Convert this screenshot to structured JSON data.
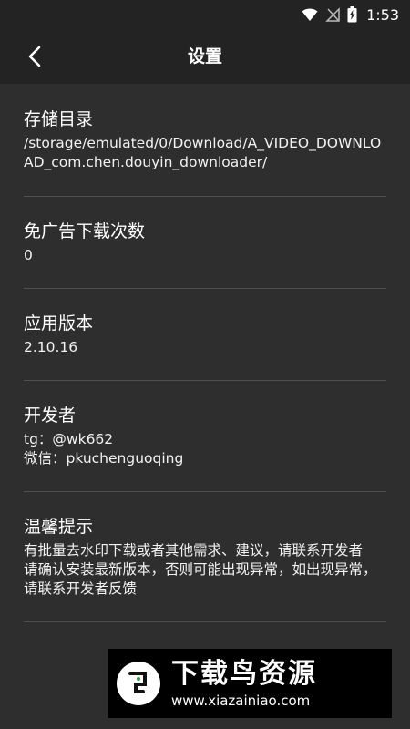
{
  "status_bar": {
    "time": "1:53",
    "icons": [
      "wifi-icon",
      "signal-off-icon",
      "battery-charging-icon"
    ]
  },
  "app_bar": {
    "title": "设置",
    "back_icon": "chevron-left-icon"
  },
  "settings": {
    "storage": {
      "title": "存储目录",
      "value": "/storage/emulated/0/Download/A_VIDEO_DOWNLOAD_com.chen.douyin_downloader/"
    },
    "ad_free": {
      "title": "免广告下载次数",
      "value": "0"
    },
    "version": {
      "title": "应用版本",
      "value": "2.10.16"
    },
    "developer": {
      "title": "开发者",
      "lines": [
        "tg：@wk662",
        "微信：pkuchenguoqing"
      ]
    },
    "tips": {
      "title": "温馨提示",
      "lines": [
        "有批量去水印下载或者其他需求、建议，请联系开发者",
        "请确认安装最新版本，否则可能出现异常，如出现异常，请联系开发者反馈"
      ]
    }
  },
  "watermark": {
    "brand": "下载鸟资源",
    "url": "www.xiazainiao.com"
  },
  "colors": {
    "background": "#2e2e2e",
    "app_bar": "#232323",
    "divider": "#505050",
    "text": "#ffffff"
  }
}
